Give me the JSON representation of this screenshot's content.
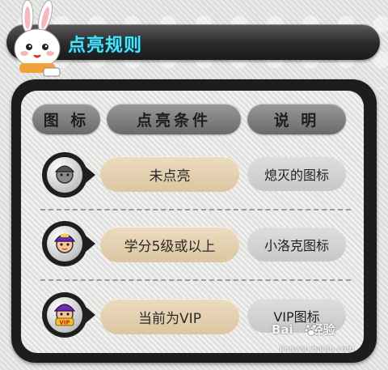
{
  "title": "点亮规则",
  "headers": [
    "图 标",
    "点亮条件",
    "说 明"
  ],
  "rows": [
    {
      "icon": "gray-avatar-icon",
      "condition": "未点亮",
      "description": "熄灭的图标"
    },
    {
      "icon": "purple-hat-avatar-icon",
      "condition": "学分5级或以上",
      "description": "小洛克图标"
    },
    {
      "icon": "vip-avatar-icon",
      "condition": "当前为VIP",
      "description": "VIP图标"
    }
  ],
  "watermark": {
    "brand_left": "Bai",
    "brand_right": "经验",
    "url": "jingyan.baidu.com"
  },
  "colors": {
    "title": "#4ee1f7",
    "condition_bg": "#e4d1b1",
    "panel": "#1d1d1d"
  }
}
